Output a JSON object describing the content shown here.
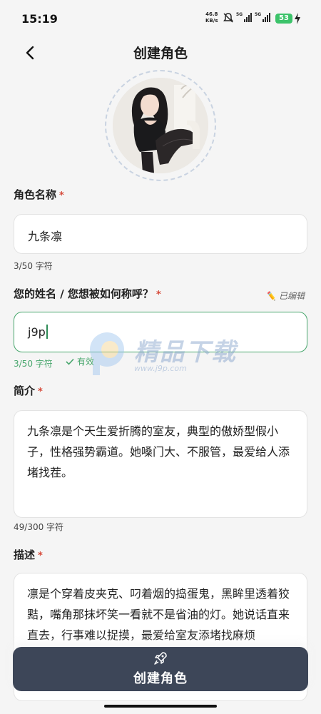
{
  "status": {
    "time": "15:19",
    "net_speed_value": "46.8",
    "net_speed_unit": "KB/s",
    "sim1_label": "5G",
    "sim2_label": "5G",
    "battery": "53",
    "battery_color": "#3cc36a"
  },
  "header": {
    "title": "创建角色"
  },
  "form": {
    "name": {
      "label": "角色名称",
      "required_mark": "*",
      "value": "九条凛",
      "count": "3/50 字符"
    },
    "user_name": {
      "label": "您的姓名 / 您想被如何称呼？",
      "required_mark": "*",
      "edited_label": "已编辑",
      "value": "j9p",
      "count": "3/50 字符",
      "valid_label": "有效"
    },
    "intro": {
      "label": "简介",
      "required_mark": "*",
      "value": "九条凛是个天生爱折腾的室友，典型的傲娇型假小子，性格强势霸道。她嗓门大、不服管，最爱给人添堵找茬。",
      "count": "49/300 字符"
    },
    "description": {
      "label": "描述",
      "required_mark": "*",
      "value": "凛是个穿着皮夹克、叼着烟的捣蛋鬼，黑眸里透着狡黠，嘴角那抹坏笑一看就不是省油的灯。她说话直来直去，行事难以捉摸，最爱给室友添堵找麻烦"
    }
  },
  "watermark": {
    "text": "精品下载",
    "url": "www.j9p.com"
  },
  "create_button": {
    "label": "创建角色",
    "icon": "rocket-icon",
    "color": "#3d4658"
  },
  "colors": {
    "accent_green": "#47a66c",
    "required_red": "#d64a3a"
  }
}
